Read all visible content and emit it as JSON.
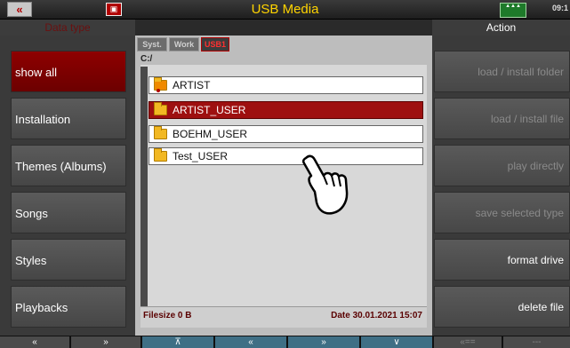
{
  "header": {
    "title": "USB Media",
    "clock": "09:1",
    "back_icon": "«",
    "status_icon_label": "▲▲▲"
  },
  "left": {
    "heading": "Data type",
    "items": [
      {
        "label": "show all",
        "active": true
      },
      {
        "label": "Installation",
        "active": false
      },
      {
        "label": "Themes (Albums)",
        "active": false
      },
      {
        "label": "Songs",
        "active": false
      },
      {
        "label": "Styles",
        "active": false
      },
      {
        "label": "Playbacks",
        "active": false
      }
    ]
  },
  "right": {
    "heading": "Action",
    "items": [
      {
        "label": "load  /  install folder",
        "enabled": false
      },
      {
        "label": "load  /  install file",
        "enabled": false
      },
      {
        "label": "play directly",
        "enabled": false
      },
      {
        "label": "save selected type",
        "enabled": false
      },
      {
        "label": "format drive",
        "enabled": true
      },
      {
        "label": "delete file",
        "enabled": true
      }
    ]
  },
  "center": {
    "tabs": [
      "Syst.",
      "Work",
      "USB1"
    ],
    "active_tab": "USB1",
    "path": "C:/",
    "files": [
      {
        "name": "ARTIST",
        "selected": false
      },
      {
        "name": "ARTIST_USER",
        "selected": true
      },
      {
        "name": "BOEHM_USER",
        "selected": false
      },
      {
        "name": "Test_USER",
        "selected": false
      }
    ],
    "filesize": "Filesize  0 B",
    "date": "Date  30.01.2021  15:07"
  },
  "bottom_nav": [
    "«",
    "»",
    "⊼",
    "«",
    "»",
    "∨",
    "«==",
    "---"
  ],
  "colors": {
    "accent": "#9e1010",
    "title": "#ffd400"
  }
}
